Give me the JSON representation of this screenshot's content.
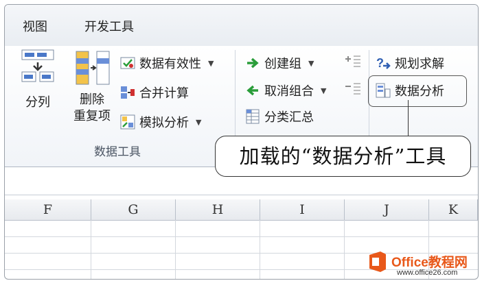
{
  "tabs": [
    "视图",
    "开发工具"
  ],
  "data_tools": {
    "split_label": "分列",
    "remove_dup_line1": "删除",
    "remove_dup_line2": "重复项",
    "validation": "数据有效性",
    "consolidate": "合并计算",
    "whatif": "模拟分析",
    "group_label": "数据工具"
  },
  "outline": {
    "group": "创建组",
    "ungroup": "取消组合",
    "subtotal": "分类汇总"
  },
  "analysis": {
    "solver": "规划求解",
    "data_analysis": "数据分析"
  },
  "callout": "加载的“数据分析”工具",
  "columns": [
    "F",
    "G",
    "H",
    "I",
    "J",
    "K"
  ],
  "watermark": {
    "name": "Office教程网",
    "url": "www.office26.com"
  },
  "colors": {
    "accent": "#e8581a",
    "border": "#9aa0a8"
  }
}
